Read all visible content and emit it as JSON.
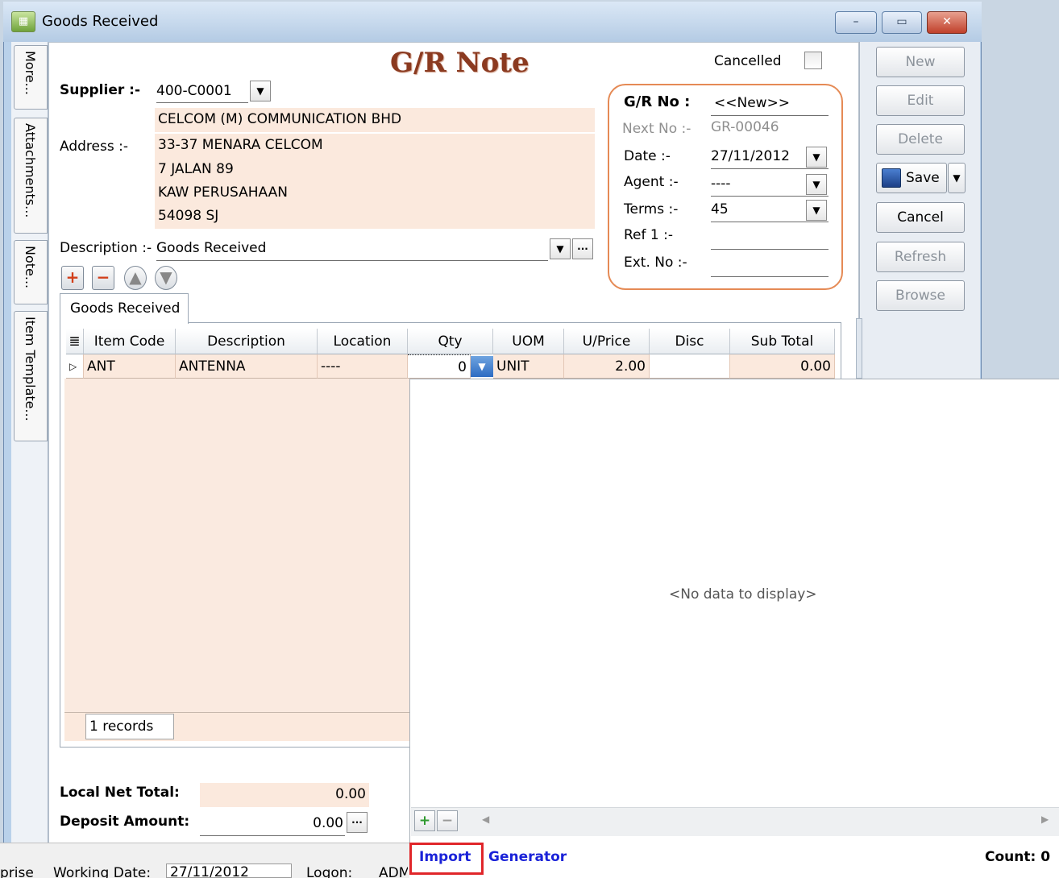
{
  "window": {
    "title": "Goods Received",
    "controls": [
      "–",
      "▭",
      "✕"
    ]
  },
  "side_tabs": [
    "More...",
    "Attachments...",
    "Note...",
    "Item Template..."
  ],
  "header": {
    "note_title": "G/R Note",
    "cancelled_label": "Cancelled"
  },
  "supplier": {
    "label": "Supplier :-",
    "code": "400-C0001",
    "name": "CELCOM (M) COMMUNICATION BHD",
    "address_label": "Address :-",
    "address_lines": [
      "33-37 MENARA CELCOM",
      "7 JALAN 89",
      "KAW PERUSAHAAN",
      "54098 SJ"
    ],
    "description_label": "Description :-",
    "description": "Goods Received"
  },
  "gr_box": {
    "gr_no_label": "G/R No :",
    "gr_no_value": "<<New>>",
    "next_no_label": "Next No :-",
    "next_no_value": "GR-00046",
    "date_label": "Date :-",
    "date_value": "27/11/2012",
    "agent_label": "Agent :-",
    "agent_value": "----",
    "terms_label": "Terms :-",
    "terms_value": "45",
    "ref1_label": "Ref 1 :-",
    "ref1_value": "",
    "extno_label": "Ext. No :-",
    "extno_value": ""
  },
  "actions": {
    "new": "New",
    "edit": "Edit",
    "delete": "Delete",
    "save": "Save",
    "cancel": "Cancel",
    "refresh": "Refresh",
    "browse": "Browse"
  },
  "tab_label": "Goods Received",
  "grid": {
    "columns": [
      "Item Code",
      "Description",
      "Location",
      "Qty",
      "UOM",
      "U/Price",
      "Disc",
      "Sub Total"
    ],
    "row": {
      "item_code": "ANT",
      "description": "ANTENNA",
      "location": "----",
      "qty": "0",
      "uom": "UNIT",
      "uprice": "2.00",
      "disc": "",
      "subtotal": "0.00"
    },
    "records": "1 records"
  },
  "totals": {
    "local_net_total_label": "Local Net Total:",
    "local_net_total": "0.00",
    "deposit_label": "Deposit Amount:",
    "deposit": "0.00"
  },
  "overlay": {
    "no_data": "<No data to display>",
    "import": "Import",
    "generator": "Generator",
    "count": "Count: 0"
  },
  "statusbar": {
    "left_fragment": "prise",
    "working_date_label": "Working Date:",
    "working_date": "27/11/2012",
    "logon_label": "Logon:",
    "logon_value": "ADM"
  },
  "colors": {
    "peach": "#fbe9dd",
    "orange_border": "#e58a55",
    "title_brown": "#8b3a20",
    "link_blue": "#1a22d8",
    "highlight_red": "#e0262a"
  }
}
